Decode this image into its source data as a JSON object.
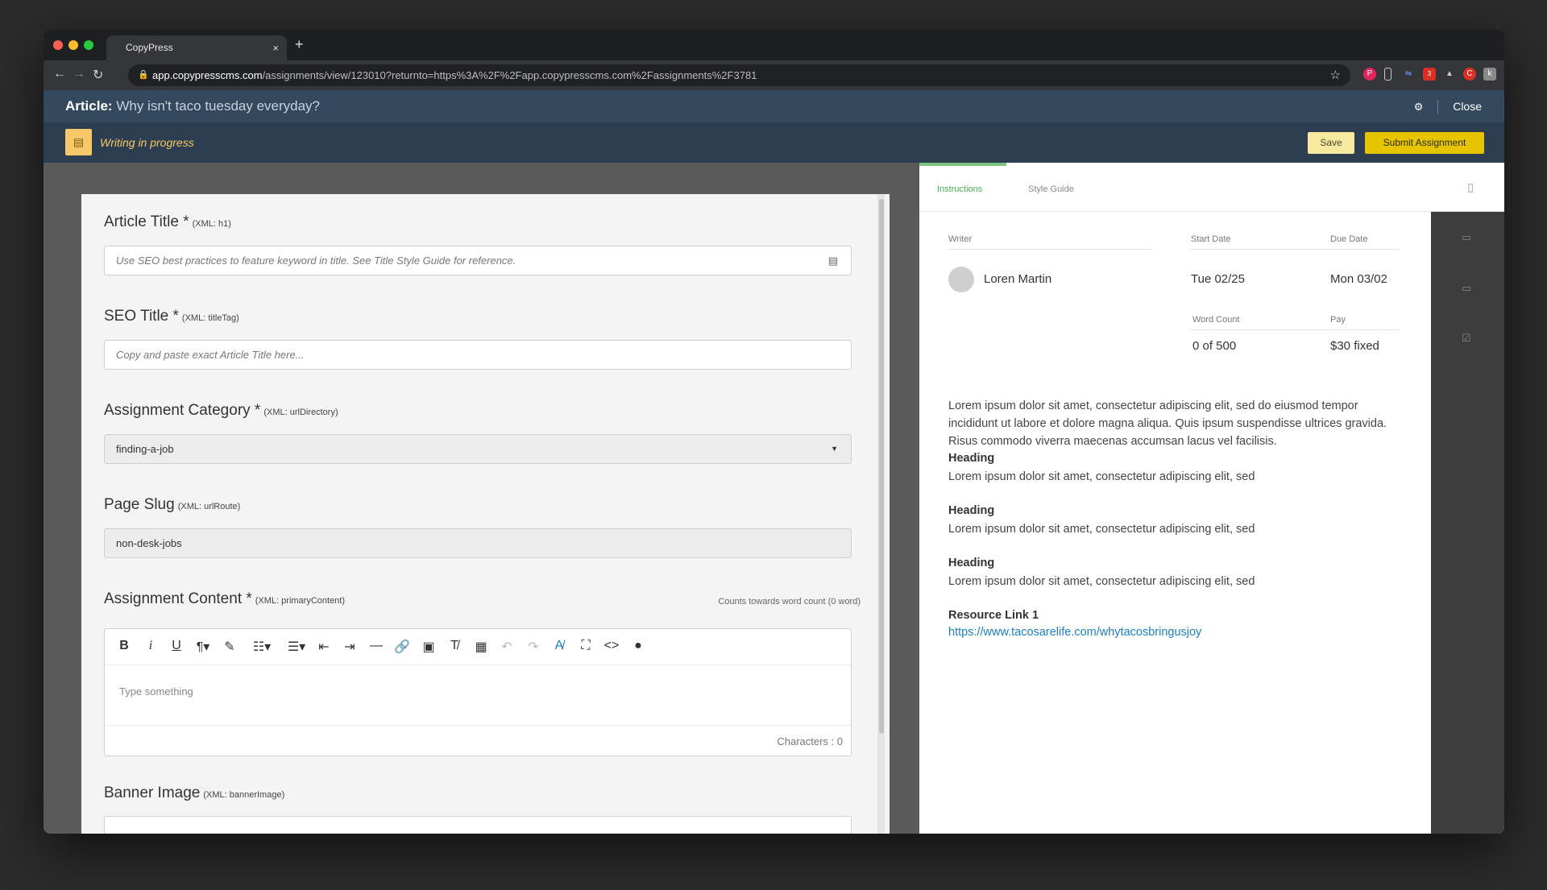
{
  "browser": {
    "tab_title": "CopyPress",
    "tab_close": "×",
    "new_tab": "+",
    "url_host": "app.copypresscms.com",
    "url_path": "/assignments/view/123010?returnto=https%3A%2F%2Fapp.copypresscms.com%2Fassignments%2F3781",
    "ext_badge": "3"
  },
  "header": {
    "article_label": "Article:",
    "article_name": "Why isn't taco tuesday everyday?",
    "close_label": "Close"
  },
  "status": {
    "text": "Writing in progress",
    "save_label": "Save",
    "submit_label": "Submit Assignment"
  },
  "form": {
    "article_title": {
      "label": "Article Title *",
      "xml": "(XML: h1)",
      "placeholder": "Use SEO best practices to feature keyword in title. See Title Style Guide for reference."
    },
    "seo_title": {
      "label": "SEO Title *",
      "xml": "(XML: titleTag)",
      "placeholder": "Copy and paste exact Article Title here..."
    },
    "category": {
      "label": "Assignment Category *",
      "xml": "(XML: urlDirectory)",
      "value": "finding-a-job"
    },
    "slug": {
      "label": "Page Slug",
      "xml": "(XML: urlRoute)",
      "value": "non-desk-jobs"
    },
    "content": {
      "label": "Assignment Content *",
      "xml": "(XML: primaryContent)",
      "counts_note": "Counts towards word count (0 word)",
      "placeholder": "Type something",
      "char_count": "Characters : 0"
    },
    "banner": {
      "label": "Banner Image",
      "xml": "(XML: bannerImage)"
    }
  },
  "editor_tools": [
    "bold-icon",
    "italic-icon",
    "underline-icon",
    "paragraph-format-icon",
    "highlighter-icon",
    "ordered-list-icon",
    "unordered-list-icon",
    "outdent-icon",
    "indent-icon",
    "horizontal-line-icon",
    "link-icon",
    "image-icon",
    "clear-format-icon",
    "table-icon",
    "undo-icon",
    "redo-icon",
    "spellcheck-icon",
    "fullscreen-icon",
    "code-view-icon",
    "comment-icon"
  ],
  "sidebar": {
    "tabs": [
      "Instructions",
      "Style Guide"
    ],
    "writer_label": "Writer",
    "start_label": "Start Date",
    "due_label": "Due Date",
    "writer_name": "Loren Martin",
    "start_date": "Tue 02/25",
    "due_date": "Mon 03/02",
    "wordcount_label": "Word Count",
    "pay_label": "Pay",
    "wordcount_value": "0 of 500",
    "pay_value": "$30 fixed",
    "intro": "Lorem ipsum dolor sit amet, consectetur adipiscing elit, sed do eiusmod tempor incididunt ut labore et dolore magna aliqua. Quis ipsum suspendisse ultrices gravida. Risus commodo viverra maecenas accumsan lacus vel facilisis.",
    "sections": [
      {
        "heading": "Heading",
        "text": "Lorem ipsum dolor sit amet, consectetur adipiscing elit, sed"
      },
      {
        "heading": "Heading",
        "text": "Lorem ipsum dolor sit amet, consectetur adipiscing elit, sed"
      },
      {
        "heading": "Heading",
        "text": "Lorem ipsum dolor sit amet, consectetur adipiscing elit, sed"
      }
    ],
    "resource_label": "Resource Link 1",
    "resource_url": "https://www.tacosarelife.com/whytacosbringusjoy"
  }
}
